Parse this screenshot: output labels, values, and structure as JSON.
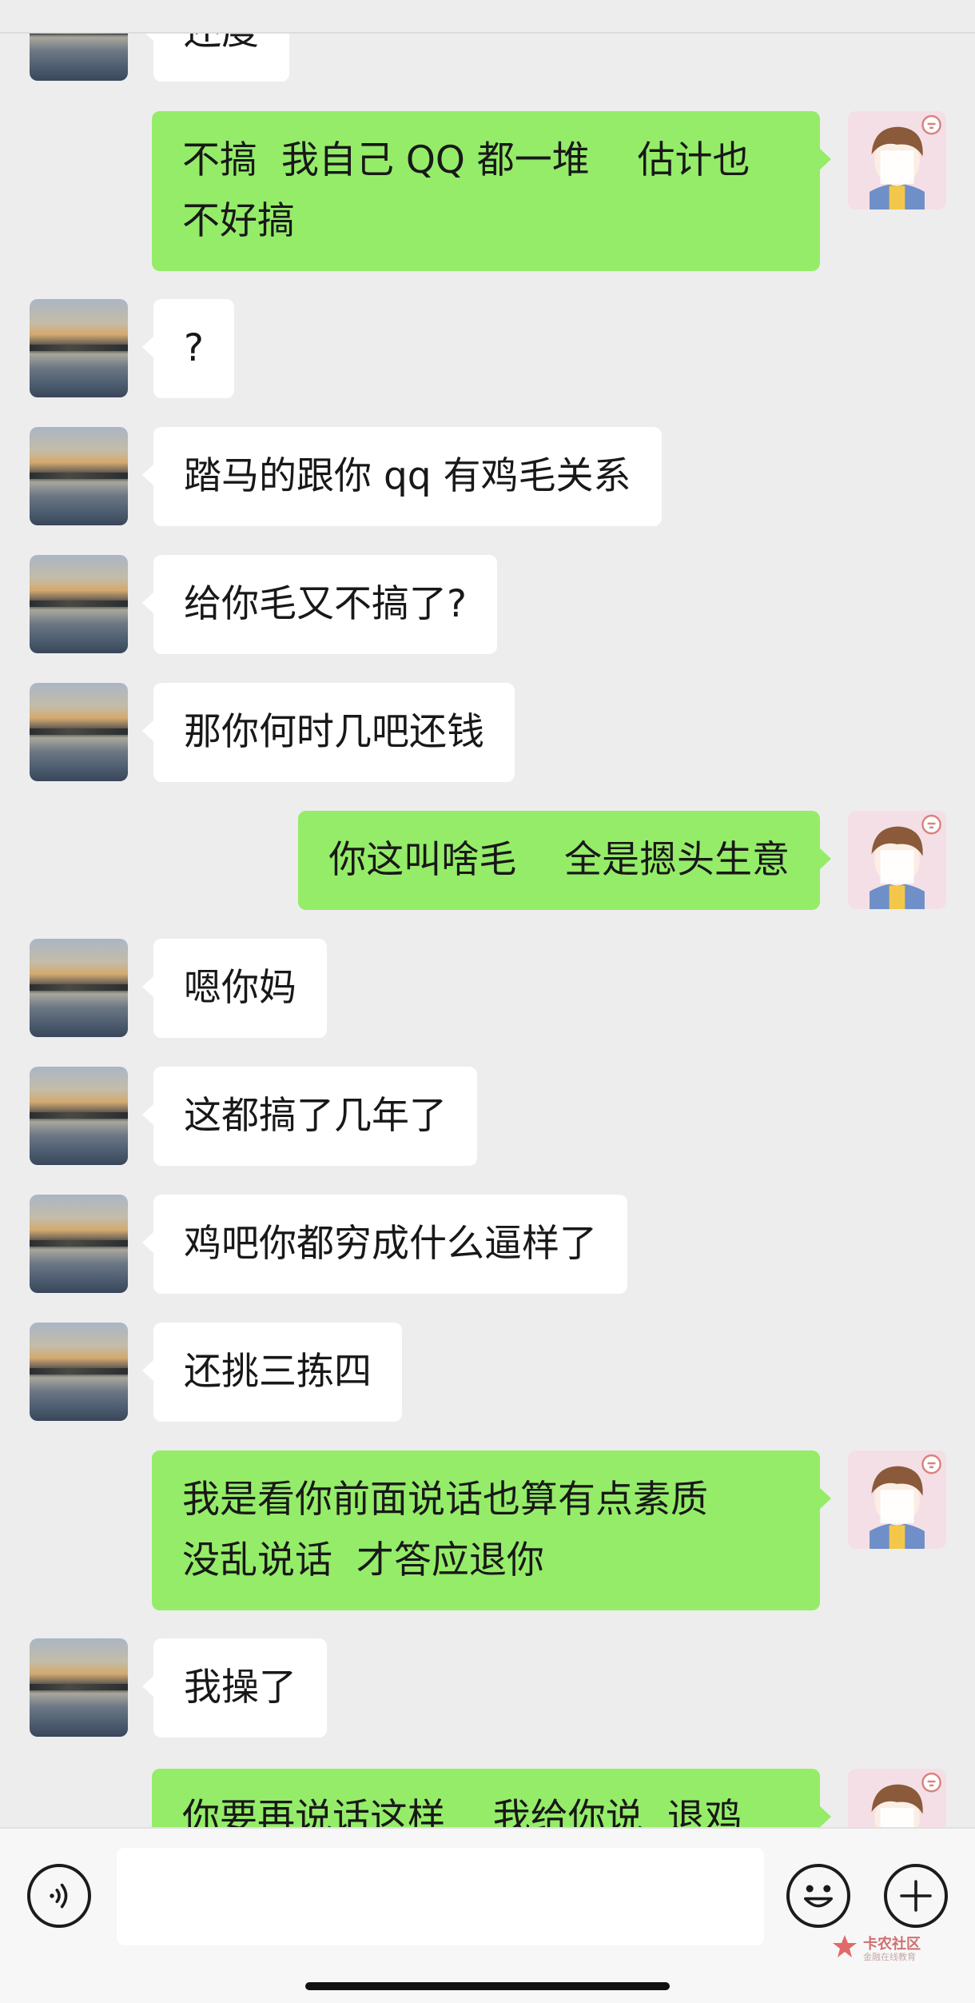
{
  "messages": [
    {
      "id": "m0",
      "side": "in",
      "text": "还度"
    },
    {
      "id": "m1",
      "side": "out",
      "text": "不搞  我自己 QQ 都一堆    估计也\n不好搞"
    },
    {
      "id": "m2",
      "side": "in",
      "text": "?"
    },
    {
      "id": "m3",
      "side": "in",
      "text": "踏马的跟你 qq 有鸡毛关系"
    },
    {
      "id": "m4",
      "side": "in",
      "text": "给你毛又不搞了?"
    },
    {
      "id": "m5",
      "side": "in",
      "text": "那你何时几吧还钱"
    },
    {
      "id": "m6",
      "side": "out",
      "text": "你这叫啥毛    全是摁头生意"
    },
    {
      "id": "m7",
      "side": "in",
      "text": "嗯你妈"
    },
    {
      "id": "m8",
      "side": "in",
      "text": "这都搞了几年了"
    },
    {
      "id": "m9",
      "side": "in",
      "text": "鸡吧你都穷成什么逼样了"
    },
    {
      "id": "m10",
      "side": "in",
      "text": "还挑三拣四"
    },
    {
      "id": "m11",
      "side": "out",
      "text": "我是看你前面说话也算有点素质\n没乱说话  才答应退你"
    },
    {
      "id": "m12",
      "side": "in",
      "text": "我操了"
    },
    {
      "id": "m13",
      "side": "out",
      "text": "你要再说话这样    我给你说  退鸡"
    }
  ],
  "avatars": {
    "contact": "lake-sunset-avatar",
    "self": "cartoon-boy-avatar"
  },
  "input_bar": {
    "placeholder": "",
    "icons": [
      "voice-icon",
      "emoji-icon",
      "plus-icon"
    ]
  },
  "watermark": {
    "text": "卡农社区",
    "subtext": "金融在线教育"
  },
  "colors": {
    "background": "#ededed",
    "outgoing_bubble": "#95ec69",
    "incoming_bubble": "#ffffff",
    "text": "#181818"
  }
}
